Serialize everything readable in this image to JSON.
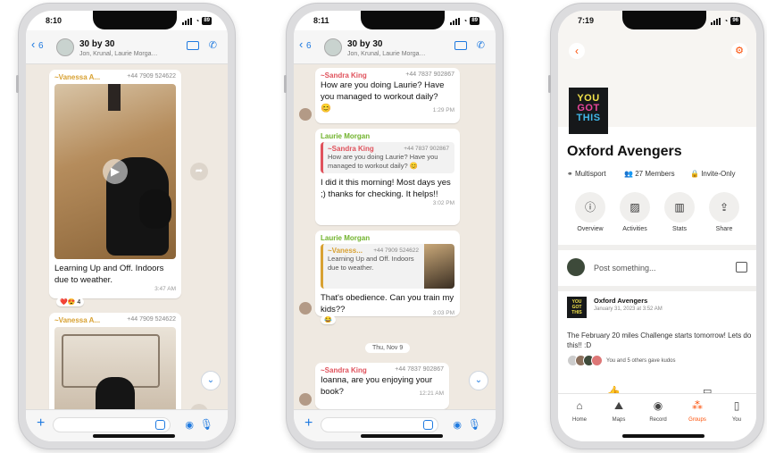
{
  "phone1": {
    "time": "8:10",
    "battery": "89",
    "back_count": "6",
    "group_title": "30 by 30",
    "group_sub": "Jon, Krunal, Laurie Morga…",
    "msg1": {
      "sender": "~Vanessa A...",
      "phone": "+44 7909 524622",
      "text": "Learning Up and Off. Indoors due to weather.",
      "time": "3:47 AM",
      "reaction": "4"
    },
    "msg2": {
      "sender": "~Vanessa A...",
      "phone": "+44 7909 524622"
    }
  },
  "phone2": {
    "time": "8:11",
    "battery": "89",
    "back_count": "6",
    "group_title": "30 by 30",
    "group_sub": "Jon, Krunal, Laurie Morga…",
    "m1": {
      "sender": "~Sandra King",
      "phone": "+44 7837 902867",
      "text": "How are you doing Laurie? Have you managed to workout daily?",
      "emoji": "😊",
      "time": "1:29 PM"
    },
    "m2": {
      "sender": "Laurie Morgan",
      "quote_sender": "~Sandra King",
      "quote_phone": "+44 7837 902867",
      "quote_text": "How are you doing Laurie? Have you managed to workout daily? 😊",
      "text": "I did it this morning! Most days yes ;) thanks for checking. It helps!!",
      "time": "3:02 PM"
    },
    "m3": {
      "sender": "Laurie Morgan",
      "quote_sender": "~Vaness...",
      "quote_phone": "+44 7909 524622",
      "quote_text": "Learning Up and Off. Indoors due to weather.",
      "text": "That's obedience. Can you train my kids??",
      "time": "3:03 PM"
    },
    "date": "Thu, Nov 9",
    "m4": {
      "sender": "~Sandra King",
      "phone": "+44 7837 902867",
      "text": "Ioanna, are you enjoying your book?",
      "time": "12:21 AM"
    }
  },
  "phone3": {
    "time": "7:19",
    "battery": "96",
    "logo": [
      "YOU",
      "GOT",
      "THIS"
    ],
    "club_name": "Oxford Avengers",
    "meta": {
      "sport": "Multisport",
      "members": "27 Members",
      "privacy": "Invite-Only"
    },
    "actions": [
      "Overview",
      "Activities",
      "Stats",
      "Share"
    ],
    "post_placeholder": "Post something...",
    "feed": {
      "title": "Oxford Avengers",
      "date": "January 31, 2023 at 3:52 AM",
      "text": "The February 20 miles Challenge starts tomorrow! Lets do this!! :D",
      "kudos": "You and 5 others gave kudos"
    },
    "tabs": [
      "Home",
      "Maps",
      "Record",
      "Groups",
      "You"
    ],
    "accent": "#fc4c02"
  },
  "colors": {
    "ios_blue": "#1f7ae0",
    "chat_bg": "#efe9e1",
    "sandra": "#e0525c",
    "laurie": "#71b32d",
    "vanessa": "#d8a132"
  }
}
